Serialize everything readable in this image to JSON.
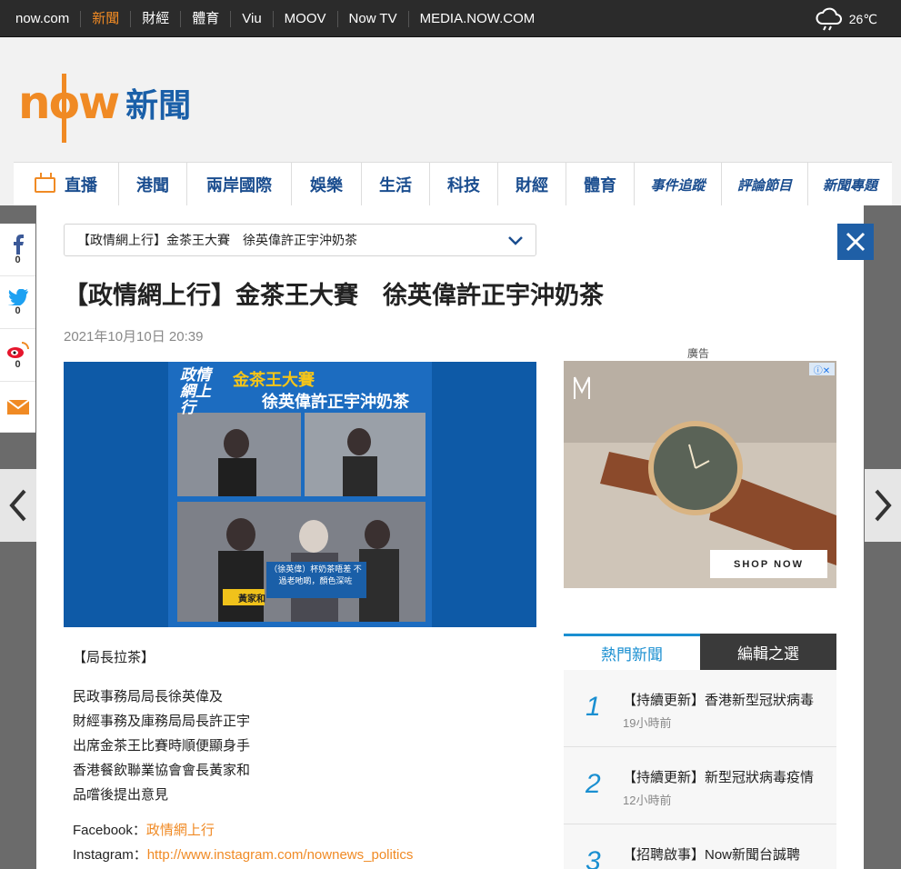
{
  "topbar": {
    "links": [
      "now.com",
      "新聞",
      "財經",
      "體育",
      "Viu",
      "MOOV",
      "Now TV",
      "MEDIA.NOW.COM"
    ],
    "active_index": 1,
    "temperature": "26℃"
  },
  "logo": {
    "brand": "now",
    "section": "新聞"
  },
  "nav": {
    "items": [
      "直播",
      "港聞",
      "兩岸國際",
      "娛樂",
      "生活",
      "科技",
      "財經",
      "體育",
      "事件追蹤",
      "評論節目",
      "新聞專題"
    ]
  },
  "share": {
    "facebook_count": "0",
    "twitter_count": "0",
    "weibo_count": "0"
  },
  "article": {
    "select_value": "【政情網上行】金茶王大賽　徐英偉許正宇沖奶茶",
    "headline": "【政情網上行】金茶王大賽　徐英偉許正宇沖奶茶",
    "date": "2021年10月10日 20:39",
    "image_overlay": {
      "brand": "政情網上行",
      "title1": "金茶王大賽",
      "title2": "徐英偉許正宇沖奶茶",
      "caption": "（徐英偉）杯奶茶唔差 不過老吔啲，顏色深咗",
      "speaker": "黃家和"
    },
    "section_label": "【局長拉茶】",
    "paragraph_lines": [
      "民政事務局局長徐英偉及",
      "財經事務及庫務局局長許正宇",
      "出席金茶王比賽時順便顯身手",
      "香港餐飲聯業協會會長黃家和",
      "品嚐後提出意見"
    ],
    "facebook_label": "Facebook：",
    "facebook_link": "政情網上行",
    "instagram_label": "Instagram：",
    "instagram_link": "http://www.instagram.com/nownews_politics"
  },
  "ad": {
    "label": "廣告",
    "cta": "SHOP NOW"
  },
  "sidebar": {
    "tabs": [
      "熱門新聞",
      "編輯之選"
    ],
    "hot": [
      {
        "num": "1",
        "title": "【持續更新】香港新型冠狀病毒",
        "time": "19小時前"
      },
      {
        "num": "2",
        "title": "【持續更新】新型冠狀病毒疫情",
        "time": "12小時前"
      },
      {
        "num": "3",
        "title": "【招聘啟事】Now新聞台誠聘",
        "time": ""
      }
    ]
  }
}
